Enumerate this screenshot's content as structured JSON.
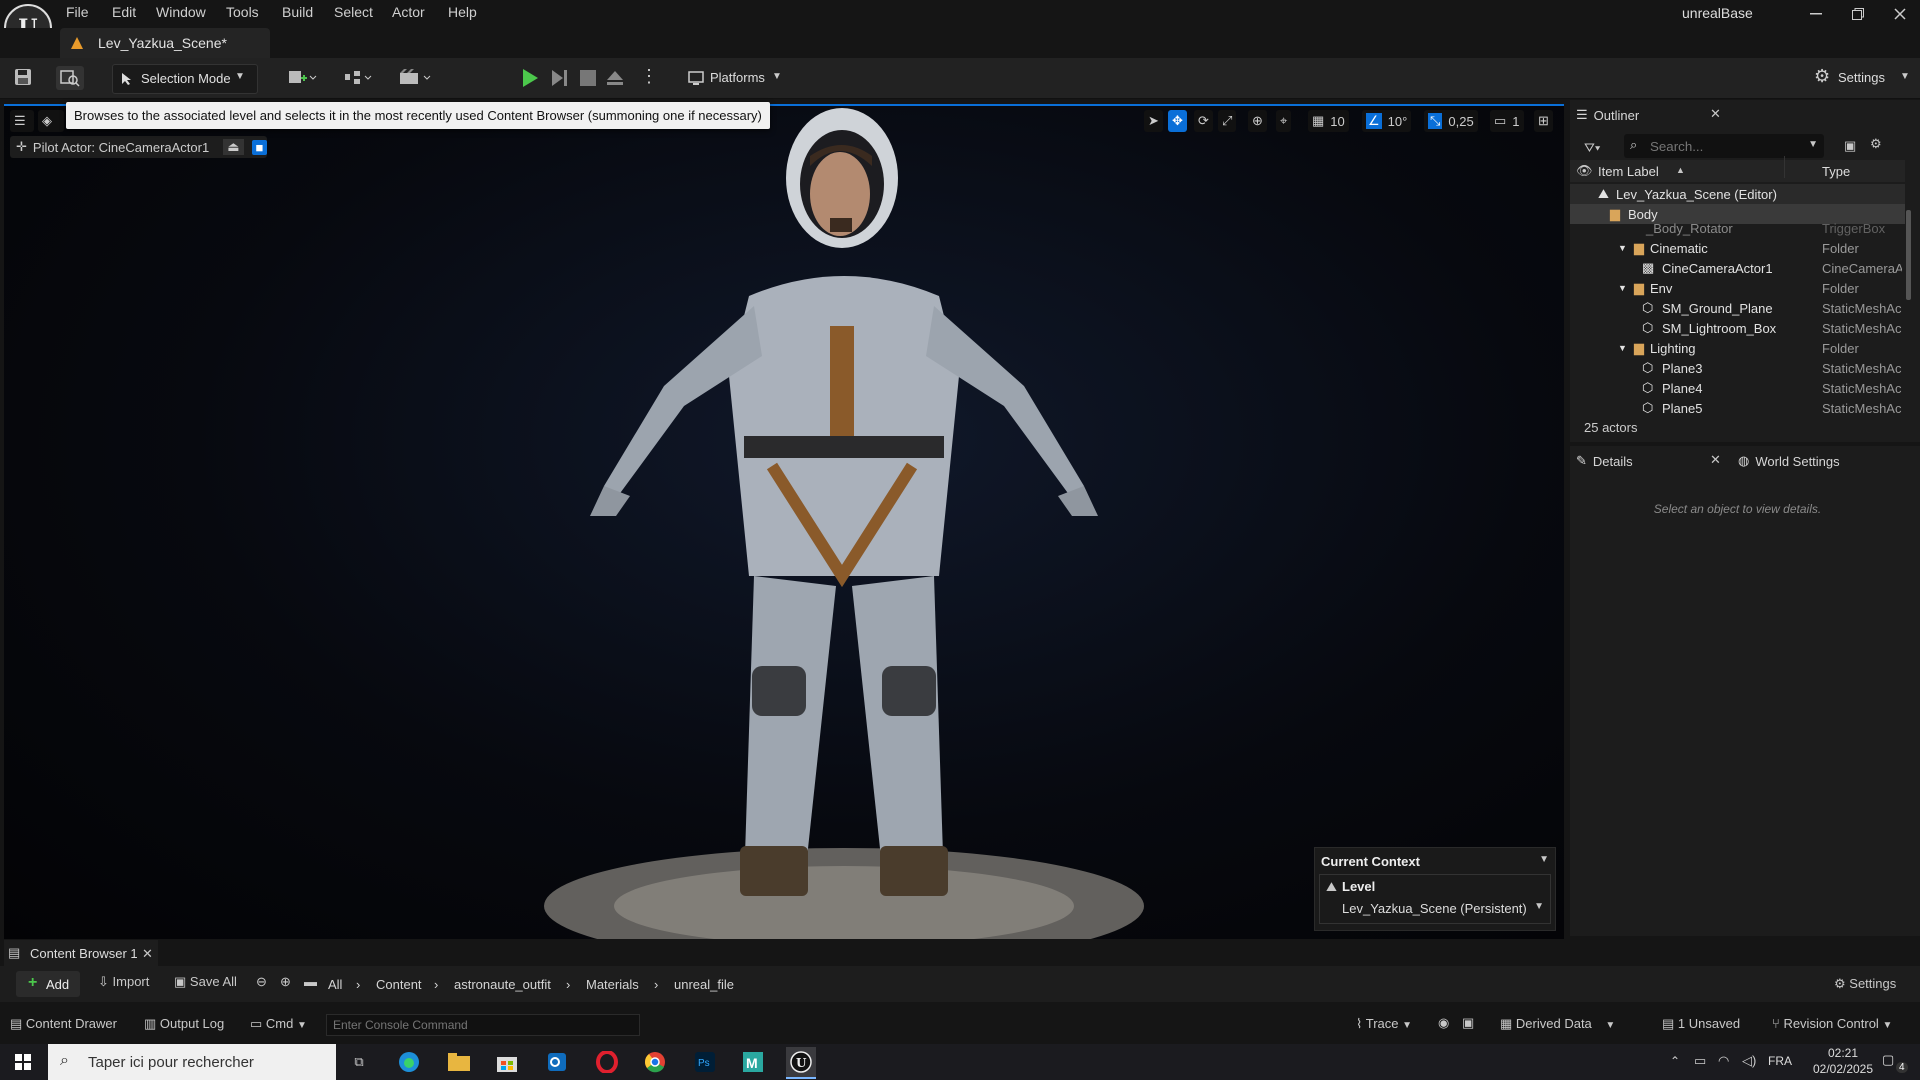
{
  "app": {
    "title": "unrealBase"
  },
  "menu": [
    "File",
    "Edit",
    "Window",
    "Tools",
    "Build",
    "Select",
    "Actor",
    "Help"
  ],
  "document_tab": {
    "label": "Lev_Yazkua_Scene*"
  },
  "toolbar": {
    "selection_mode": "Selection Mode",
    "platforms": "Platforms",
    "settings": "Settings"
  },
  "tooltip": "Browses to the associated level and selects it in the most recently used Content Browser (summoning one if necessary)",
  "viewport": {
    "pilot_label": "Pilot Actor: CineCameraActor1",
    "grid_value": "10",
    "angle_value": "10°",
    "scale_value": "0,25",
    "camera_speed": "1",
    "context": {
      "title": "Current Context",
      "level_label": "Level",
      "level_value": "Lev_Yazkua_Scene (Persistent)"
    }
  },
  "outliner": {
    "tab_label": "Outliner",
    "search_placeholder": "Search...",
    "col_label": "Item Label",
    "col_type": "Type",
    "rows": [
      {
        "label": "Lev_Yazkua_Scene (Editor)",
        "type": ""
      },
      {
        "label": "Body",
        "type": ""
      },
      {
        "label": "_Body_Rotator",
        "type": "TriggerBox"
      },
      {
        "label": "Cinematic",
        "type": "Folder"
      },
      {
        "label": "CineCameraActor1",
        "type": "CineCameraA"
      },
      {
        "label": "Env",
        "type": "Folder"
      },
      {
        "label": "SM_Ground_Plane",
        "type": "StaticMeshAc"
      },
      {
        "label": "SM_Lightroom_Box",
        "type": "StaticMeshAc"
      },
      {
        "label": "Lighting",
        "type": "Folder"
      },
      {
        "label": "Plane3",
        "type": "StaticMeshAc"
      },
      {
        "label": "Plane4",
        "type": "StaticMeshAc"
      },
      {
        "label": "Plane5",
        "type": "StaticMeshAc"
      }
    ],
    "count": "25 actors"
  },
  "details": {
    "tab_label": "Details",
    "world_settings_label": "World Settings",
    "empty_message": "Select an object to view details."
  },
  "content_browser": {
    "tab_label": "Content Browser 1",
    "add": "Add",
    "import": "Import",
    "save_all": "Save All",
    "breadcrumbs": [
      "All",
      "Content",
      "astronaute_outfit",
      "Materials",
      "unreal_file"
    ],
    "settings": "Settings"
  },
  "statusbar": {
    "content_drawer": "Content Drawer",
    "output_log": "Output Log",
    "cmd": "Cmd",
    "console_placeholder": "Enter Console Command",
    "trace": "Trace",
    "derived_data": "Derived Data",
    "unsaved": "1 Unsaved",
    "revision_control": "Revision Control"
  },
  "taskbar": {
    "search_placeholder": "Taper ici pour rechercher",
    "lang": "FRA",
    "time": "02:21",
    "date": "02/02/2025",
    "notifications": "4"
  }
}
